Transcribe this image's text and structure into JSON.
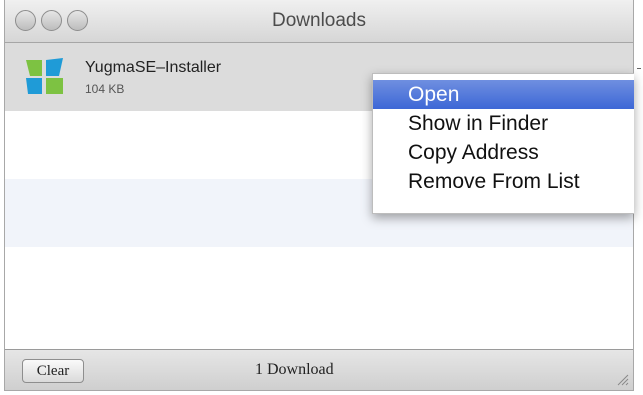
{
  "window": {
    "title": "Downloads"
  },
  "downloads": [
    {
      "name": "YugmaSE–Installer",
      "size": "104 KB",
      "icon": "app-icon"
    }
  ],
  "context_menu": {
    "items": [
      {
        "label": "Open",
        "highlighted": true
      },
      {
        "label": "Show in Finder"
      },
      {
        "label": "Copy Address"
      },
      {
        "label": "Remove From List"
      }
    ]
  },
  "statusbar": {
    "clear_label": "Clear",
    "count_label": "1 Download"
  },
  "colors": {
    "selection": "#3d67d6",
    "stripe": "#f1f4fa",
    "icon_green": "#7dc242",
    "icon_blue": "#1f9bd7"
  }
}
